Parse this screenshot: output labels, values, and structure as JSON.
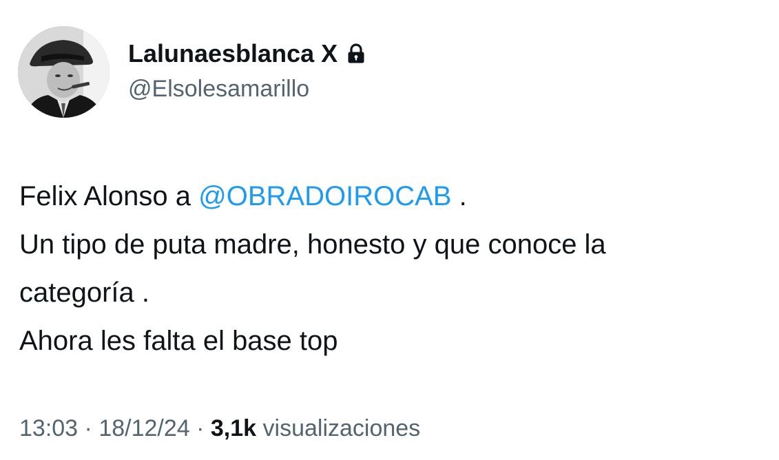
{
  "user": {
    "display_name": "Lalunaesblanca X",
    "handle": "@Elsolesamarillo",
    "lock_icon": "lock-icon"
  },
  "tweet": {
    "line1_prefix": "Felix Alonso a ",
    "mention": "@OBRADOIROCAB",
    "line1_suffix": " .",
    "line2": "Un tipo de puta madre, honesto y que conoce la",
    "line3": "categoría .",
    "line4": "Ahora les falta el base top"
  },
  "meta": {
    "time": "13:03",
    "separator": " · ",
    "date": "18/12/24",
    "views_count": "3,1k",
    "views_label": " visualizaciones"
  },
  "colors": {
    "text": "#0f1419",
    "secondary": "#536471",
    "link": "#1d9bf0",
    "background": "#ffffff"
  }
}
